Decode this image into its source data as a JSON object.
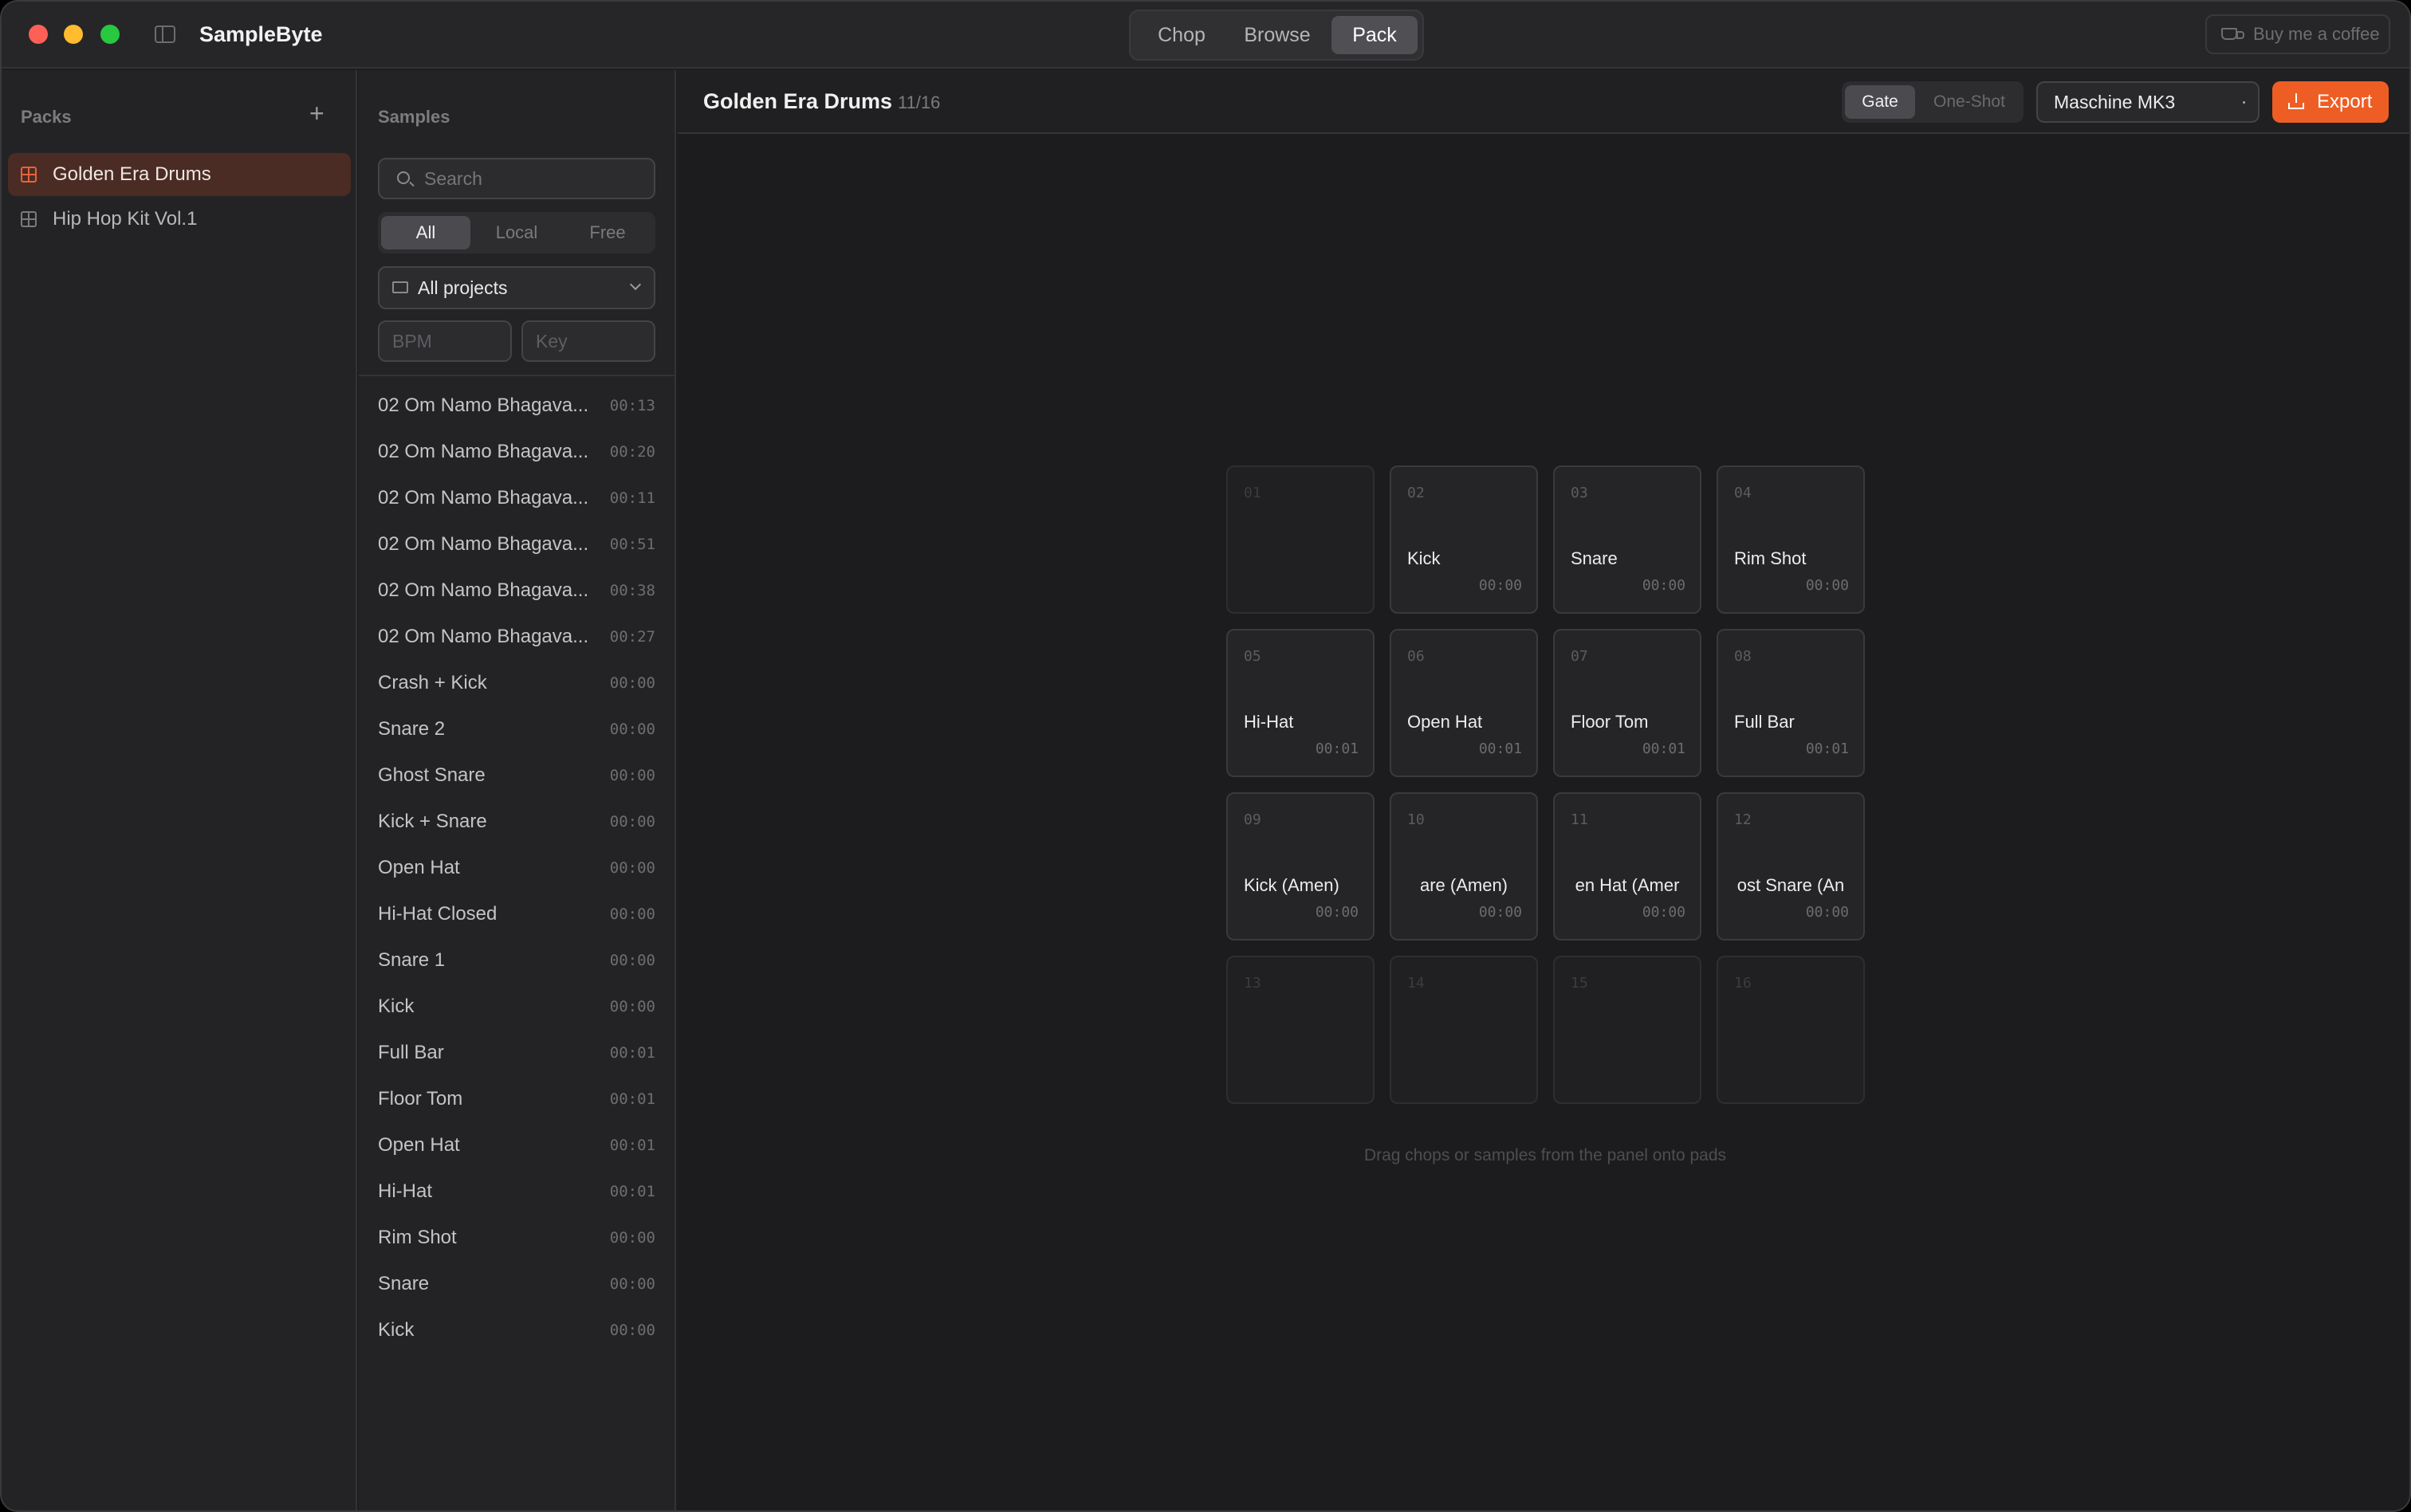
{
  "app": {
    "title": "SampleByte",
    "tabs": [
      "Chop",
      "Browse",
      "Pack"
    ],
    "active_tab": "Pack",
    "coffee_label": "Buy me a coffee"
  },
  "packs": {
    "heading": "Packs",
    "add_label": "+",
    "items": [
      {
        "label": "Golden Era Drums",
        "active": true
      },
      {
        "label": "Hip Hop Kit Vol.1",
        "active": false
      }
    ]
  },
  "samples": {
    "heading": "Samples",
    "search_placeholder": "Search",
    "filters": [
      "All",
      "Local",
      "Free"
    ],
    "active_filter": "All",
    "project_select": "All projects",
    "bpm_placeholder": "BPM",
    "key_placeholder": "Key",
    "items": [
      {
        "name": "02 Om Namo Bhagava...",
        "duration": "00:13"
      },
      {
        "name": "02 Om Namo Bhagava...",
        "duration": "00:20"
      },
      {
        "name": "02 Om Namo Bhagava...",
        "duration": "00:11"
      },
      {
        "name": "02 Om Namo Bhagava...",
        "duration": "00:51"
      },
      {
        "name": "02 Om Namo Bhagava...",
        "duration": "00:38"
      },
      {
        "name": "02 Om Namo Bhagava...",
        "duration": "00:27"
      },
      {
        "name": "Crash + Kick",
        "duration": "00:00"
      },
      {
        "name": "Snare 2",
        "duration": "00:00"
      },
      {
        "name": "Ghost Snare",
        "duration": "00:00"
      },
      {
        "name": "Kick + Snare",
        "duration": "00:00"
      },
      {
        "name": "Open Hat",
        "duration": "00:00"
      },
      {
        "name": "Hi-Hat Closed",
        "duration": "00:00"
      },
      {
        "name": "Snare 1",
        "duration": "00:00"
      },
      {
        "name": "Kick",
        "duration": "00:00"
      },
      {
        "name": "Full Bar",
        "duration": "00:01"
      },
      {
        "name": "Floor Tom",
        "duration": "00:01"
      },
      {
        "name": "Open Hat",
        "duration": "00:01"
      },
      {
        "name": "Hi-Hat",
        "duration": "00:01"
      },
      {
        "name": "Rim Shot",
        "duration": "00:00"
      },
      {
        "name": "Snare",
        "duration": "00:00"
      },
      {
        "name": "Kick",
        "duration": "00:00"
      }
    ]
  },
  "main": {
    "pack_title": "Golden Era Drums",
    "pad_count": "11/16",
    "modes": [
      "Gate",
      "One-Shot"
    ],
    "active_mode": "Gate",
    "device": "Maschine MK3",
    "export_label": "Export",
    "hint": "Drag chops or samples from the panel onto pads",
    "pads": [
      {
        "num": "01",
        "label": "",
        "duration": ""
      },
      {
        "num": "02",
        "label": "Kick",
        "duration": "00:00"
      },
      {
        "num": "03",
        "label": "Snare",
        "duration": "00:00"
      },
      {
        "num": "04",
        "label": "Rim Shot",
        "duration": "00:00"
      },
      {
        "num": "05",
        "label": "Hi-Hat",
        "duration": "00:01"
      },
      {
        "num": "06",
        "label": "Open Hat",
        "duration": "00:01"
      },
      {
        "num": "07",
        "label": "Floor Tom",
        "duration": "00:01"
      },
      {
        "num": "08",
        "label": "Full Bar",
        "duration": "00:01"
      },
      {
        "num": "09",
        "label": "Kick (Amen)",
        "duration": "00:00"
      },
      {
        "num": "10",
        "label": "are (Amen)",
        "duration": "00:00"
      },
      {
        "num": "11",
        "label": "en Hat (Amer",
        "duration": "00:00"
      },
      {
        "num": "12",
        "label": "ost Snare (An",
        "duration": "00:00"
      },
      {
        "num": "13",
        "label": "",
        "duration": ""
      },
      {
        "num": "14",
        "label": "",
        "duration": ""
      },
      {
        "num": "15",
        "label": "",
        "duration": ""
      },
      {
        "num": "16",
        "label": "",
        "duration": ""
      }
    ]
  },
  "colors": {
    "accent": "#ee5d24",
    "close": "#fe5f57",
    "minimize": "#febc2e",
    "zoom": "#28c840"
  }
}
